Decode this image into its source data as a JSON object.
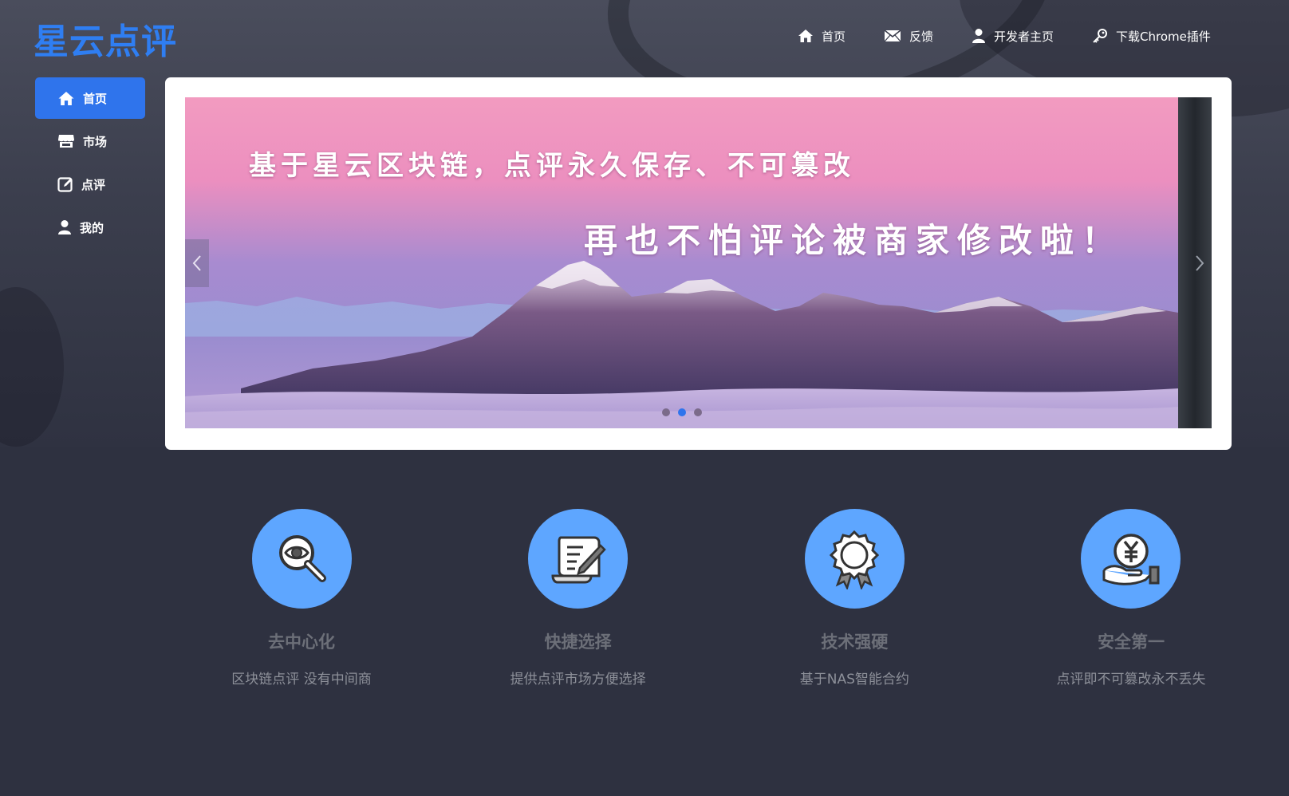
{
  "brand": {
    "name": "星云点评",
    "color": "#2f7ef2"
  },
  "topnav": [
    {
      "icon": "home-icon",
      "label": "首页"
    },
    {
      "icon": "mail-icon",
      "label": "反馈"
    },
    {
      "icon": "user-icon",
      "label": "开发者主页"
    },
    {
      "icon": "key-icon",
      "label": "下载Chrome插件"
    }
  ],
  "sidebar": [
    {
      "icon": "home-icon",
      "label": "首页",
      "active": true
    },
    {
      "icon": "store-icon",
      "label": "市场",
      "active": false
    },
    {
      "icon": "edit-icon",
      "label": "点评",
      "active": false
    },
    {
      "icon": "user-icon",
      "label": "我的",
      "active": false
    }
  ],
  "carousel": {
    "caption_line1": "基于星云区块链，点评永久保存、不可篡改",
    "caption_line2": "再也不怕评论被商家修改啦！",
    "slide_count": 3,
    "active_index": 1
  },
  "features": [
    {
      "icon": "magnifier-eye-icon",
      "title": "去中心化",
      "desc": "区块链点评 没有中间商"
    },
    {
      "icon": "scroll-pen-icon",
      "title": "快捷选择",
      "desc": "提供点评市场方便选择"
    },
    {
      "icon": "award-badge-icon",
      "title": "技术强硬",
      "desc": "基于NAS智能合约"
    },
    {
      "icon": "yuan-hand-icon",
      "title": "安全第一",
      "desc": "点评即不可篡改永不丢失"
    }
  ],
  "colors": {
    "accent": "#2f74ec",
    "feature_circle": "#5ea6ff",
    "background": "#2e3140"
  }
}
